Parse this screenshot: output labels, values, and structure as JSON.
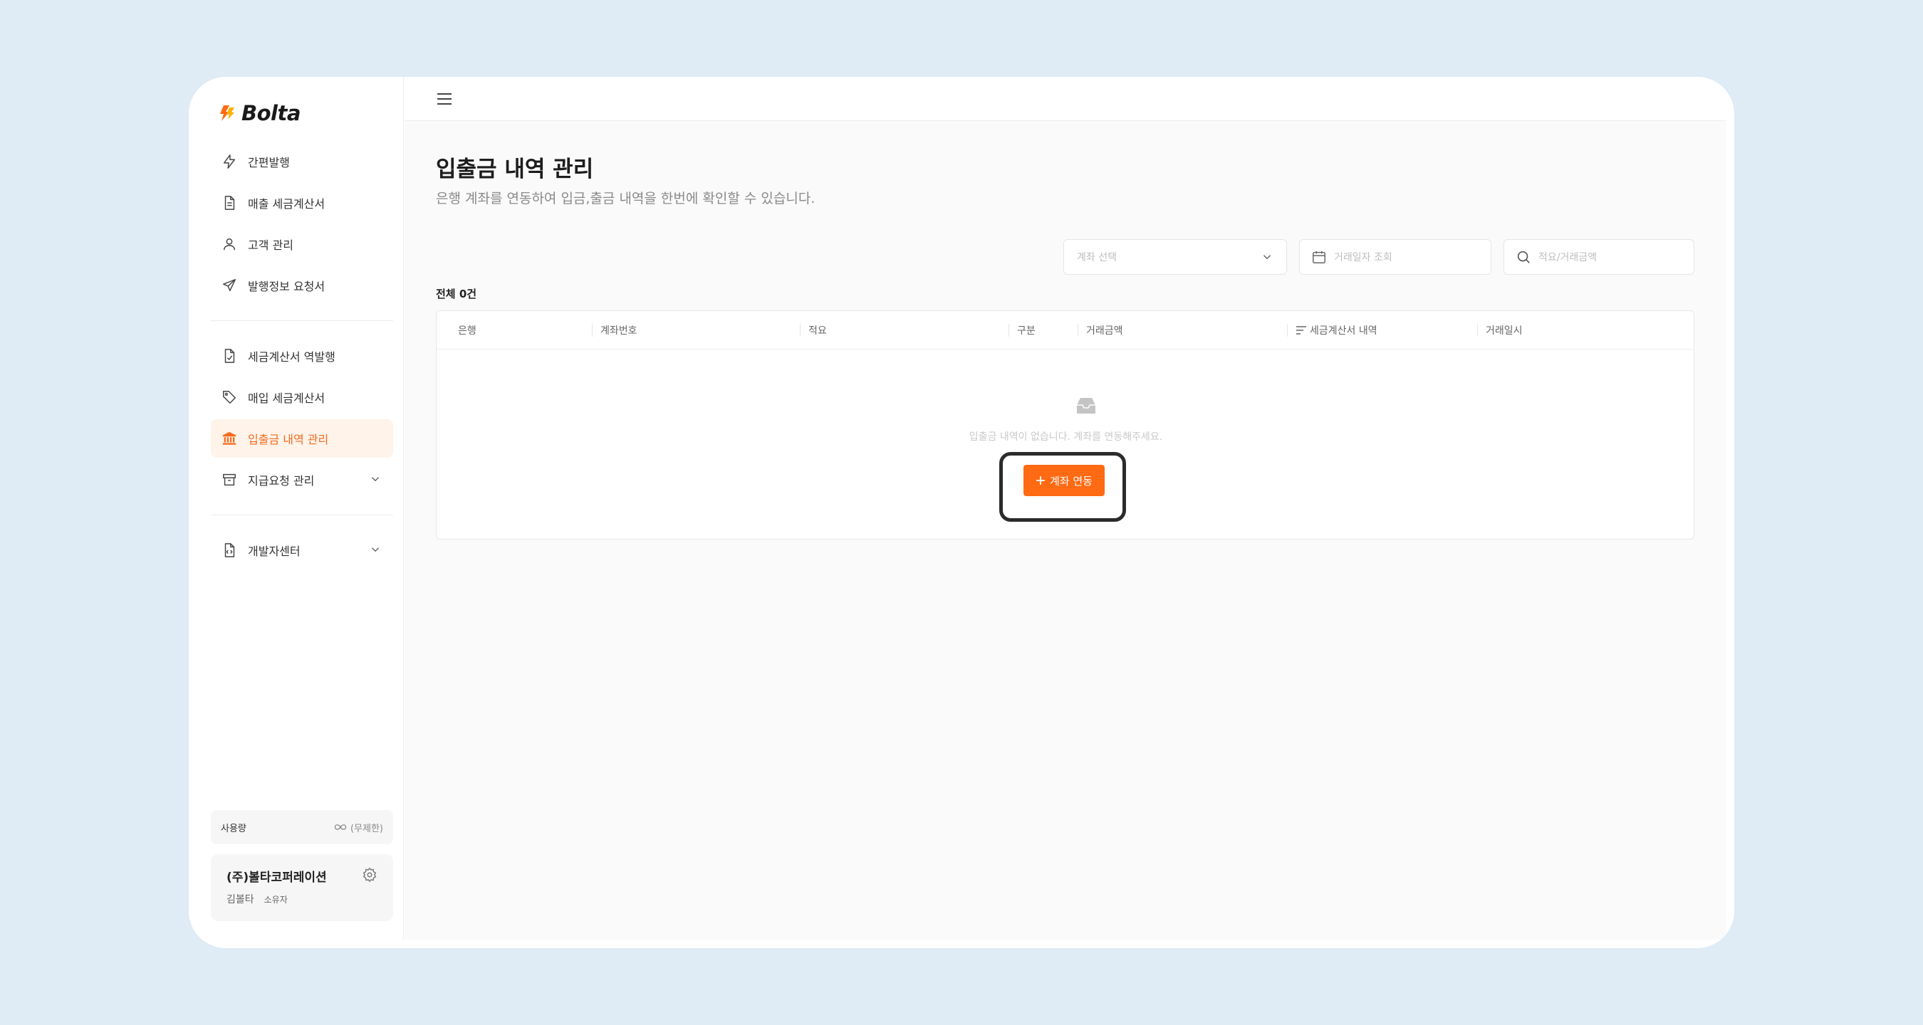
{
  "app": {
    "logo_text": "Bolta",
    "accent": "#ff6a13"
  },
  "sidebar": {
    "items": [
      {
        "label": "간편발행",
        "icon": "lightning-icon"
      },
      {
        "label": "매출 세금계산서",
        "icon": "document-icon"
      },
      {
        "label": "고객 관리",
        "icon": "user-icon"
      },
      {
        "label": "발행정보 요청서",
        "icon": "send-icon"
      },
      {
        "label": "세금계산서 역발행",
        "icon": "file-check-icon"
      },
      {
        "label": "매입 세금계산서",
        "icon": "tag-icon"
      },
      {
        "label": "입출금 내역 관리",
        "icon": "bank-icon",
        "active": true
      },
      {
        "label": "지급요청 관리",
        "icon": "archive-icon",
        "expandable": true
      },
      {
        "label": "개발자센터",
        "icon": "code-file-icon",
        "expandable": true
      }
    ],
    "usage": {
      "label": "사용량",
      "value": "(무제한)"
    },
    "company": {
      "name": "(주)볼타코퍼레이션",
      "user": "김볼타",
      "role": "소유자"
    }
  },
  "main": {
    "title": "입출금 내역 관리",
    "description": "은행 계좌를 연동하여 입금,출금 내역을 한번에 확인할 수 있습니다.",
    "filters": {
      "account_select_placeholder": "계좌 선택",
      "date_placeholder": "거래일자 조회",
      "search_placeholder": "적요/거래금액"
    },
    "total_label": "전체 0건",
    "table": {
      "columns": [
        "은행",
        "계좌번호",
        "적요",
        "구분",
        "거래금액",
        "세금계산서 내역",
        "거래일시"
      ],
      "empty_text": "입출금 내역이 없습니다. 계좌를 연동해주세요.",
      "link_button": "계좌 연동"
    }
  }
}
